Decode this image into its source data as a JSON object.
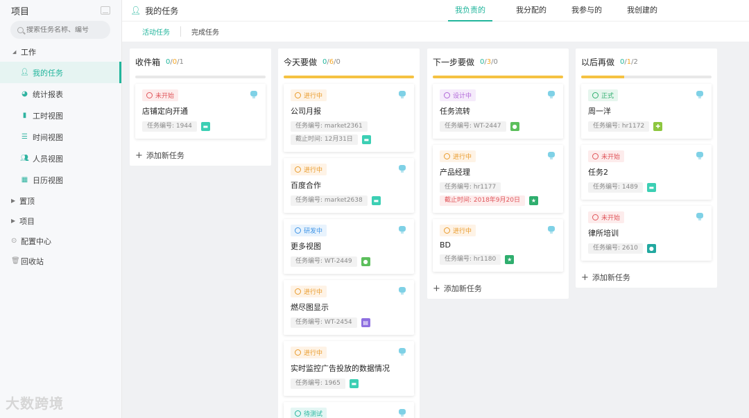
{
  "sidebar": {
    "title": "项目",
    "search_placeholder": "搜索任务名称、编号",
    "group_work": "工作",
    "items": [
      {
        "label": "我的任务",
        "icon": "user-icon",
        "active": true
      },
      {
        "label": "统计报表",
        "icon": "pie-chart-icon"
      },
      {
        "label": "工时视图",
        "icon": "bar-chart-icon"
      },
      {
        "label": "时间视图",
        "icon": "timeline-icon"
      },
      {
        "label": "人员视图",
        "icon": "people-icon"
      },
      {
        "label": "日历视图",
        "icon": "calendar-icon"
      }
    ],
    "pinned": "置顶",
    "projects": "项目",
    "config": "配置中心",
    "recycle": "回收站",
    "watermark": "大数跨境"
  },
  "header": {
    "title": "我的任务",
    "tabs": [
      "我负责的",
      "我分配的",
      "我参与的",
      "我创建的"
    ],
    "active_tab": "我负责的",
    "subtabs": [
      "活动任务",
      "完成任务"
    ]
  },
  "columns": [
    {
      "name": "收件箱",
      "counts": [
        "0",
        "0",
        "1"
      ],
      "progress": 0,
      "add_label": "添加新任务",
      "cards": [
        {
          "status": "未开始",
          "title": "店铺定向开通",
          "code": "任务编号: 1944",
          "icon": "teal"
        }
      ]
    },
    {
      "name": "今天要做",
      "counts": [
        "0",
        "6",
        "0"
      ],
      "progress": 1,
      "cards": [
        {
          "status": "进行中",
          "title": "公司月报",
          "code": "任务编号: market2361",
          "due": "截止时间: 12月31日",
          "icon": "teal"
        },
        {
          "status": "进行中",
          "title": "百度合作",
          "code": "任务编号: market2638",
          "icon": "teal"
        },
        {
          "status": "研发中",
          "title": "更多视图",
          "code": "任务编号: WT-2449",
          "icon": "green-bulb"
        },
        {
          "status": "进行中",
          "title": "燃尽图显示",
          "code": "任务编号: WT-2454",
          "icon": "purple-clipboard"
        },
        {
          "status": "进行中",
          "title": "实时监控广告投放的数据情况",
          "code": "任务编号: 1965",
          "icon": "teal"
        },
        {
          "status": "待测试",
          "title": "",
          "code": "",
          "icon": ""
        }
      ]
    },
    {
      "name": "下一步要做",
      "counts": [
        "0",
        "3",
        "0"
      ],
      "progress": 1,
      "add_label": "添加新任务",
      "cards": [
        {
          "status": "设计中",
          "title": "任务流转",
          "code": "任务编号: WT-2447",
          "icon": "green-bulb"
        },
        {
          "status": "进行中",
          "title": "产品经理",
          "code": "任务编号: hr1177",
          "due_red": "截止时间: 2018年9月20日",
          "icon": "green-star"
        },
        {
          "status": "进行中",
          "title": "BD",
          "code": "任务编号: hr1180",
          "icon": "green-star"
        }
      ]
    },
    {
      "name": "以后再做",
      "counts": [
        "0",
        "1",
        "2"
      ],
      "progress": 0.33,
      "add_label": "添加新任务",
      "cards": [
        {
          "status": "正式",
          "title": "周一洋",
          "code": "任务编号: hr1172",
          "icon": "lime-plus"
        },
        {
          "status": "未开始",
          "title": "任务2",
          "code": "任务编号: 1489",
          "icon": "teal"
        },
        {
          "status": "未开始",
          "title": "律所培训",
          "code": "任务编号: 2610",
          "icon": "teal-chat"
        }
      ]
    }
  ]
}
